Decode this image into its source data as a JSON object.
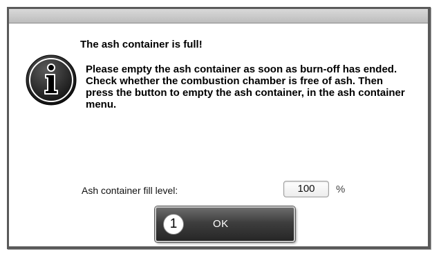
{
  "dialog": {
    "heading": "The ash container is full!",
    "message": "Please empty the ash container as soon as burn-off has ended. Check whether the combustion chamber is free of ash. Then press the button to empty the ash container, in the ash container menu.",
    "icon": "info-icon"
  },
  "fill_level": {
    "label": "Ash container fill level:",
    "value": "100",
    "unit": "%"
  },
  "ok_button": {
    "number": "1",
    "label": "OK"
  }
}
